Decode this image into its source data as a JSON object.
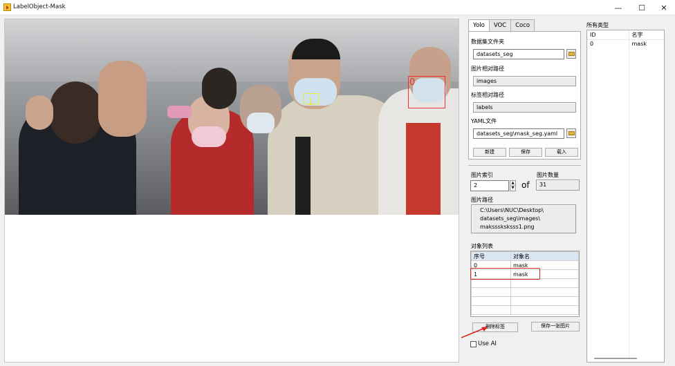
{
  "window": {
    "title": "LabelObject-Mask",
    "minimize_glyph": "—",
    "maximize_glyph": "☐",
    "close_glyph": "✕"
  },
  "image": {
    "boxes": [
      {
        "label": "0",
        "color": "#e8322f",
        "kind": "red"
      },
      {
        "label": "1",
        "color": "#e2f03a",
        "kind": "yellow"
      }
    ]
  },
  "tabs": [
    "Yolo",
    "VOC",
    "Coco"
  ],
  "yolo": {
    "dataset_folder_label": "数据集文件夹",
    "dataset_folder_value": "datasets_seg",
    "image_rel_label": "图片相对路径",
    "image_rel_value": "images",
    "label_rel_label": "标签相对路径",
    "label_rel_value": "labels",
    "yaml_label": "YAML文件",
    "yaml_value": "datasets_seg\\mask_seg.yaml",
    "btn_new": "新建",
    "btn_save": "保存",
    "btn_load": "载入"
  },
  "index": {
    "label": "图片索引",
    "value": "2",
    "of": "of",
    "count_label": "图片数量",
    "count_value": "31"
  },
  "path": {
    "label": "图片路径",
    "line1": "C:\\Users\\NUC\\Desktop\\",
    "line2": "datasets_seg\\images\\",
    "line3": "maksssksksss1.png"
  },
  "objects": {
    "label": "对象列表",
    "headers": [
      "序号",
      "对象名"
    ],
    "rows": [
      [
        "0",
        "mask"
      ],
      [
        "1",
        "mask"
      ]
    ]
  },
  "actions": {
    "delete": "删除标签",
    "save_one": "保存一张图片",
    "use_ai": "Use AI"
  },
  "all_types": {
    "label": "所有类型",
    "headers": [
      "ID",
      "名字"
    ],
    "rows": [
      [
        "0",
        "mask"
      ]
    ]
  },
  "colors": {
    "highlight": "#d9251d",
    "arrow": "#d9251d"
  }
}
